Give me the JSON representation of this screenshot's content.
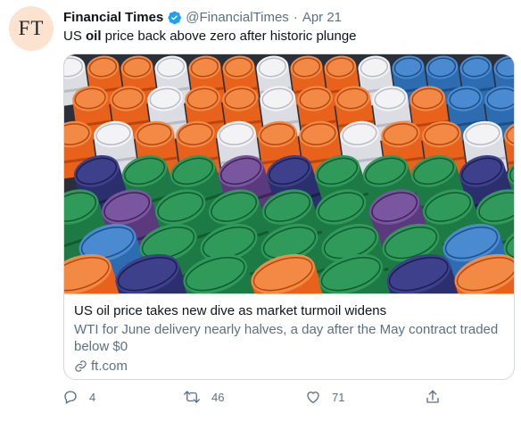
{
  "avatar": {
    "initials": "FT",
    "bg": "#fbe3cf"
  },
  "tweet": {
    "name": "Financial Times",
    "handle": "@FinancialTimes",
    "separator": "·",
    "date": "Apr 21",
    "text_pre": "US ",
    "text_bold": "oil",
    "text_post": " price back above zero after historic plunge"
  },
  "card": {
    "image_alt": "Stacked oil barrels",
    "title": "US oil price takes new dive as market turmoil widens",
    "description": "WTI for June delivery nearly halves, a day after the May contract traded below $0",
    "domain": "ft.com"
  },
  "actions": {
    "reply_count": "4",
    "retweet_count": "46",
    "like_count": "71"
  },
  "colors": {
    "verified": "#1da1f2",
    "secondary_text": "#5b7083",
    "border": "#cfd9de"
  }
}
